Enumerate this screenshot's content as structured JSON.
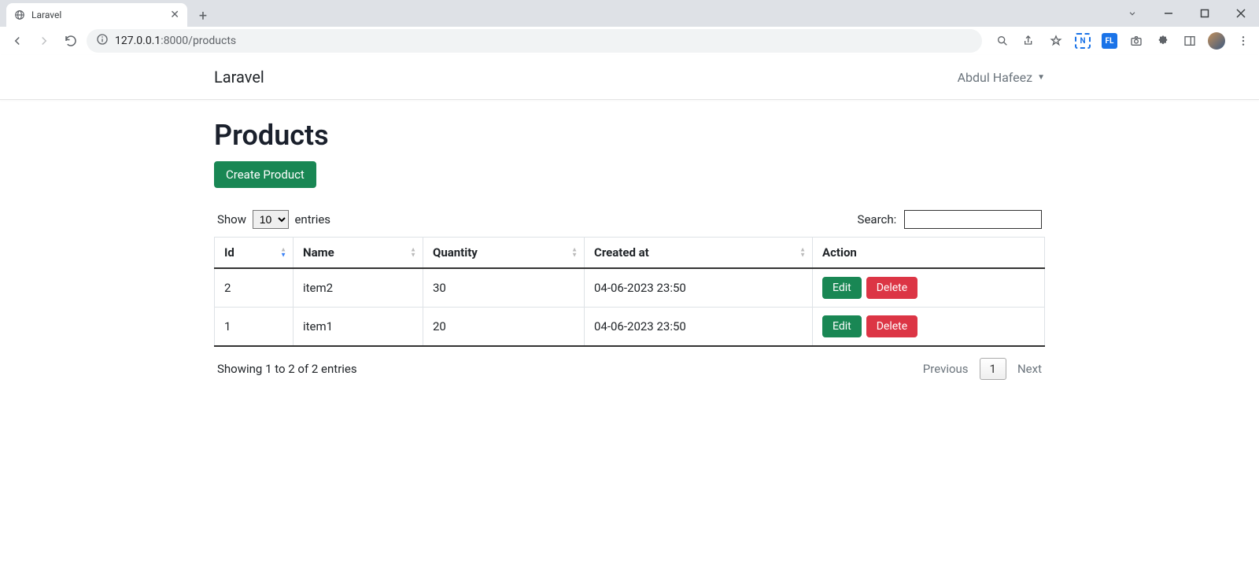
{
  "browser": {
    "tab_title": "Laravel",
    "url_host": "127.0.0.1",
    "url_port": ":8000",
    "url_path": "/products"
  },
  "navbar": {
    "brand": "Laravel",
    "user_name": "Abdul Hafeez"
  },
  "page_title": "Products",
  "create_button": "Create Product",
  "datatable": {
    "length_prefix": "Show",
    "length_value": "10",
    "length_suffix": "entries",
    "search_label": "Search:",
    "columns": {
      "id": "Id",
      "name": "Name",
      "quantity": "Quantity",
      "created_at": "Created at",
      "action": "Action"
    },
    "rows": [
      {
        "id": "2",
        "name": "item2",
        "quantity": "30",
        "created_at": "04-06-2023 23:50"
      },
      {
        "id": "1",
        "name": "item1",
        "quantity": "20",
        "created_at": "04-06-2023 23:50"
      }
    ],
    "action_edit": "Edit",
    "action_delete": "Delete",
    "info_text": "Showing 1 to 2 of 2 entries",
    "prev_label": "Previous",
    "page_number": "1",
    "next_label": "Next"
  }
}
